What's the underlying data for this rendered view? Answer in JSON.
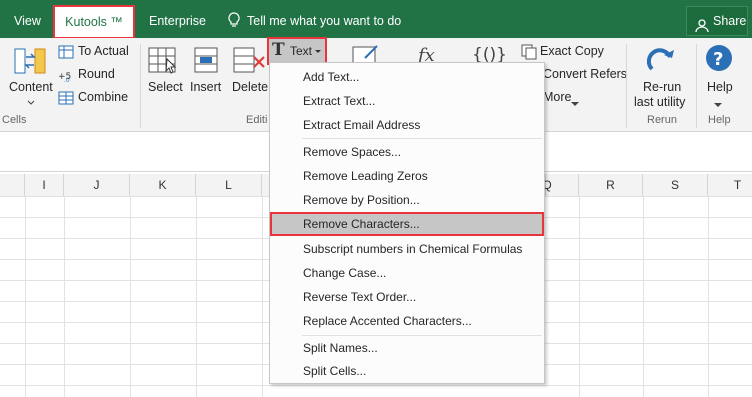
{
  "tabs": {
    "view": "View",
    "kutools": "Kutools ™",
    "enterprise": "Enterprise",
    "tell_me": "Tell me what you want to do",
    "share": "Share"
  },
  "ribbon": {
    "content": "Content",
    "to_actual": "To Actual",
    "round": "Round",
    "combine": "Combine",
    "cells_group": "Cells",
    "select": "Select",
    "insert": "Insert",
    "delete": "Delete",
    "editing_group": "Editi",
    "text_button": "Text",
    "exact_copy": "Exact Copy",
    "convert_refers": "Convert Refers",
    "more": "More",
    "rerun_line1": "Re-run",
    "rerun_line2": "last utility",
    "rerun_group": "Rerun",
    "help": "Help",
    "help_group": "Help"
  },
  "columns": [
    "I",
    "J",
    "K",
    "L",
    "Q",
    "R",
    "S",
    "T"
  ],
  "menu": {
    "items": [
      "Add Text...",
      "Extract Text...",
      "Extract Email Address",
      "Remove Spaces...",
      "Remove Leading Zeros",
      "Remove by Position...",
      "Remove Characters...",
      "Subscript numbers in Chemical Formulas",
      "Change Case...",
      "Reverse Text Order...",
      "Replace Accented Characters...",
      "Split Names...",
      "Split Cells..."
    ],
    "selected": "Remove Characters..."
  },
  "colors": {
    "accent": "#217346",
    "highlight_border": "#e8343a",
    "selected_item": "#c6c6c6"
  }
}
